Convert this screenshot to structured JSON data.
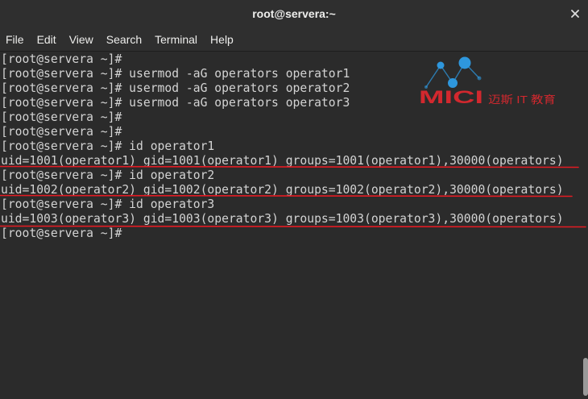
{
  "window": {
    "title": "root@servera:~",
    "close_icon": "close-icon"
  },
  "menubar": {
    "items": [
      "File",
      "Edit",
      "View",
      "Search",
      "Terminal",
      "Help"
    ]
  },
  "terminal": {
    "lines": [
      "[root@servera ~]#",
      "[root@servera ~]# usermod -aG operators operator1",
      "[root@servera ~]# usermod -aG operators operator2",
      "[root@servera ~]# usermod -aG operators operator3",
      "[root@servera ~]#",
      "[root@servera ~]#",
      "[root@servera ~]# id operator1",
      "uid=1001(operator1) gid=1001(operator1) groups=1001(operator1),30000(operators)",
      "[root@servera ~]# id operator2",
      "uid=1002(operator2) gid=1002(operator2) groups=1002(operator2),30000(operators)",
      "[root@servera ~]# id operator3",
      "uid=1003(operator3) gid=1003(operator3) groups=1003(operator3),30000(operators)",
      "[root@servera ~]#"
    ]
  },
  "watermark": {
    "brand": "MICI",
    "tagline": "迈斯 IT 教育",
    "icon": "network-nodes-icon"
  },
  "colors": {
    "chrome_bg": "#2f2f2f",
    "chrome_fg": "#eeeeec",
    "terminal_bg": "#2b2b2b",
    "terminal_fg": "#d3d3d3",
    "annotation_red": "#e31b23",
    "logo_red": "#d2282e",
    "logo_blue": "#2e97dd",
    "scrollbar_thumb": "#9a9a9a"
  }
}
